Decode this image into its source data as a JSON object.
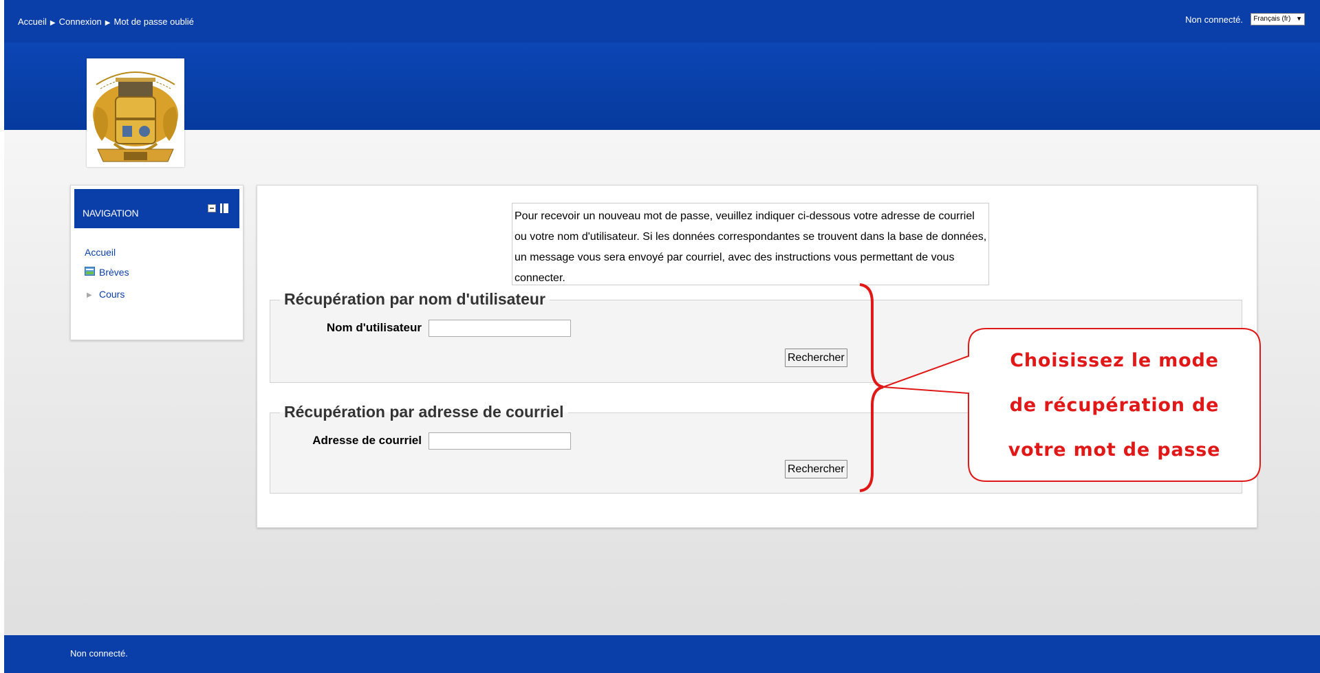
{
  "breadcrumb": {
    "home": "Accueil",
    "login": "Connexion",
    "current": "Mot de passe oublié"
  },
  "header": {
    "login_status": "Non connecté.",
    "language": "Français (fr)"
  },
  "navigation": {
    "title": "NAVIGATION",
    "items": [
      {
        "label": "Accueil"
      },
      {
        "label": "Brèves",
        "icon": "news-icon"
      },
      {
        "label": "Cours",
        "icon": "expand-arrow-icon"
      }
    ]
  },
  "main": {
    "instructions": "Pour recevoir un nouveau mot de passe, veuillez indiquer ci-dessous votre adresse de courriel ou votre nom d'utilisateur. Si les données correspondantes se trouvent dans la base de données, un message vous sera envoyé par courriel, avec des instructions vous permettant de vous connecter.",
    "username_section": {
      "legend": "Récupération par nom d'utilisateur",
      "field_label": "Nom d'utilisateur",
      "field_value": "",
      "button": "Rechercher"
    },
    "email_section": {
      "legend": "Récupération par adresse de courriel",
      "field_label": "Adresse de courriel",
      "field_value": "",
      "button": "Rechercher"
    }
  },
  "annotation": {
    "line1": "Choisissez le mode",
    "line2": "de récupération de",
    "line3": "votre mot de passe",
    "color": "#e01818"
  },
  "footer": {
    "login_status": "Non connecté."
  },
  "colors": {
    "brand_blue": "#0a3ea8",
    "page_bg": "#efefef"
  }
}
